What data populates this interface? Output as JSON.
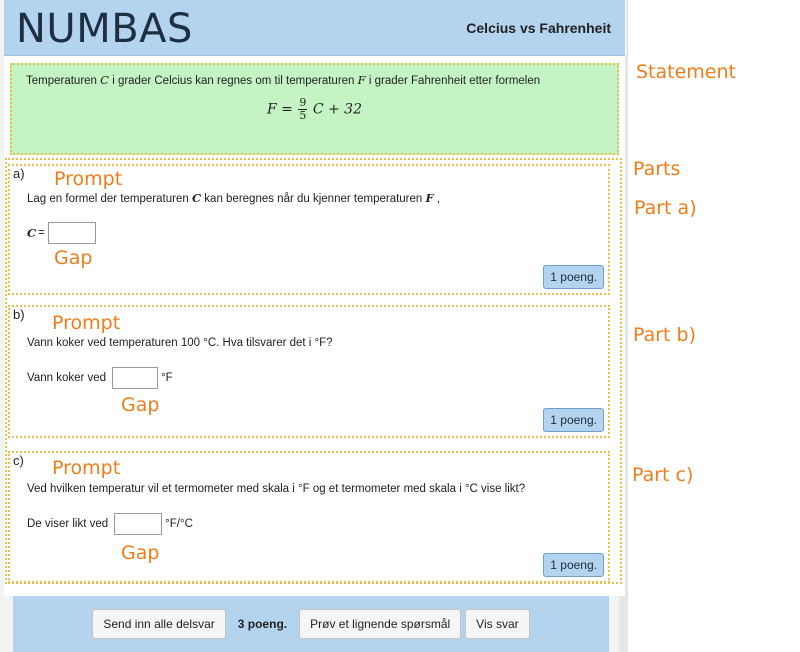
{
  "header": {
    "logo": "NUMBAS",
    "exam_title": "Celcius vs Fahrenheit"
  },
  "statement": {
    "text_before_C": "Temperaturen",
    "var_C": "C",
    "text_mid": "i grader Celcius kan regnes om til temperaturen",
    "var_F": "F",
    "text_after": "i grader Fahrenheit etter formelen",
    "formula": {
      "lhs": "F =",
      "num": "9",
      "den": "5",
      "rhs": "C + 32"
    }
  },
  "parts": [
    {
      "letter": "a)",
      "prompt_before": "Lag en formel der temperaturen",
      "prompt_var1": "C",
      "prompt_mid": "kan beregnes når du kjenner temperaturen",
      "prompt_var2": "F",
      "prompt_end": ",",
      "gap_prefix_var": "C",
      "gap_prefix": "=",
      "gap_value": "",
      "gap_suffix": "",
      "marks": "1 poeng."
    },
    {
      "letter": "b)",
      "prompt": "Vann koker ved temperaturen 100 °C. Hva tilsvarer det i °F?",
      "gap_prefix": "Vann koker ved",
      "gap_value": "",
      "gap_suffix": "°F",
      "marks": "1 poeng."
    },
    {
      "letter": "c)",
      "prompt": "Ved hvilken temperatur vil et termometer med skala i °F og et termometer med skala i °C vise likt?",
      "gap_prefix": "De viser likt ved",
      "gap_value": "",
      "gap_suffix": "°F/°C",
      "marks": "1 poeng."
    }
  ],
  "footer": {
    "submit_all": "Send inn alle delsvar",
    "total_score": "3 poeng.",
    "try_similar": "Prøv et lignende spørsmål",
    "show_answer": "Vis svar"
  },
  "annotations": {
    "statement": "Statement",
    "parts": "Parts",
    "part_a": "Part a)",
    "part_b": "Part b)",
    "part_c": "Part c)",
    "prompt": "Prompt",
    "gap": "Gap"
  },
  "colors": {
    "header_bg": "#b3d3ef",
    "statement_bg": "#c4f3c4",
    "dotted_border": "#e8c04a",
    "annotation": "#f07d1a"
  }
}
